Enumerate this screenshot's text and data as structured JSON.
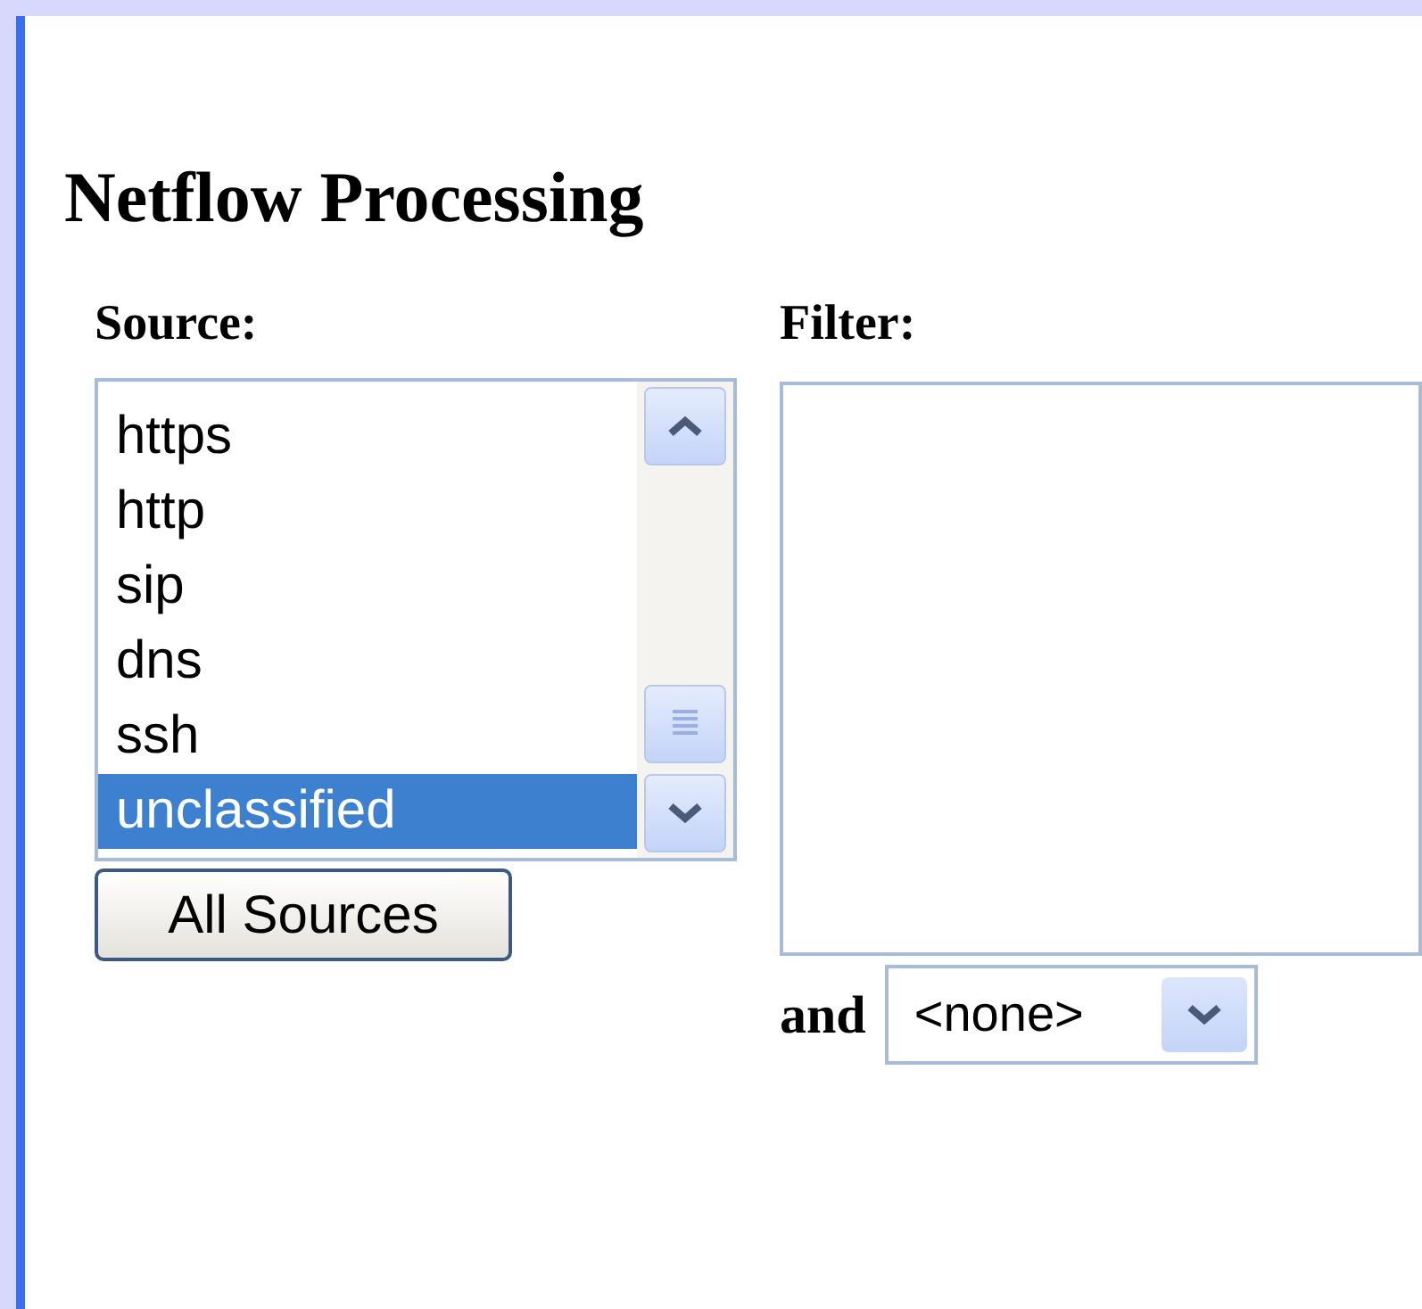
{
  "heading": "Netflow Processing",
  "source": {
    "label": "Source:",
    "items": [
      {
        "label": "https",
        "selected": false
      },
      {
        "label": "http",
        "selected": false
      },
      {
        "label": "sip",
        "selected": false
      },
      {
        "label": "dns",
        "selected": false
      },
      {
        "label": "ssh",
        "selected": false
      },
      {
        "label": "unclassified",
        "selected": true
      }
    ],
    "button": "All Sources"
  },
  "filter": {
    "label": "Filter:",
    "conjunction": "and",
    "dropdown": {
      "value": "<none>"
    }
  }
}
